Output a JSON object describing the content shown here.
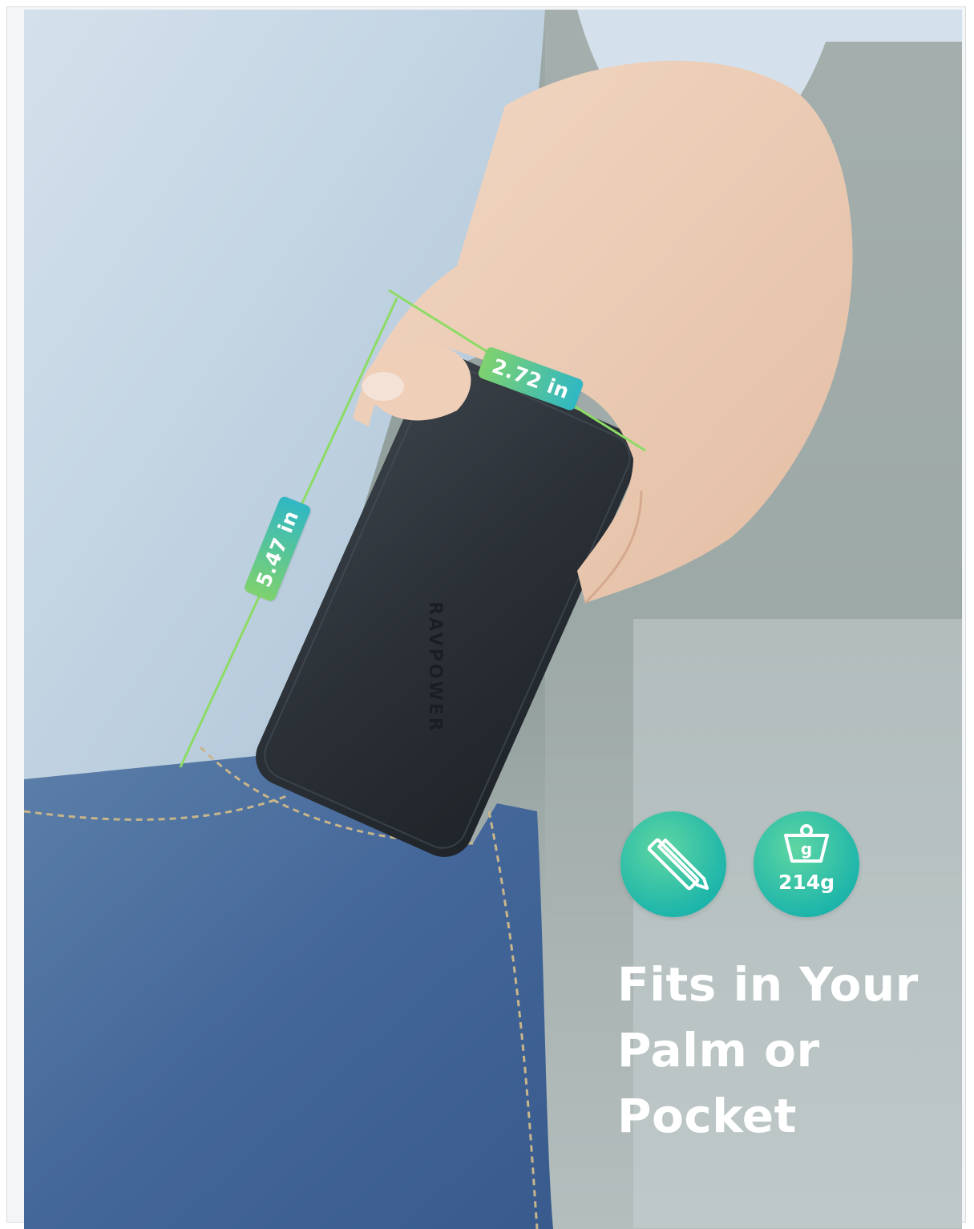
{
  "dimensions": {
    "width_label": "2.72 in",
    "length_label": "5.47 in"
  },
  "product": {
    "brand_text": "RAVPOWER"
  },
  "badges": {
    "size_icon": "pencil-ruler-icon",
    "weight_icon": "weight-icon",
    "weight_unit_glyph": "g",
    "weight_value": "214g"
  },
  "headline": {
    "line1": "Fits in Your",
    "line2": "Palm or",
    "line3": "Pocket"
  },
  "colors": {
    "accent_green": "#7fd26e",
    "accent_teal": "#2fb7c4",
    "badge_teal": "#1fb6aa",
    "headline": "#ffffff"
  }
}
